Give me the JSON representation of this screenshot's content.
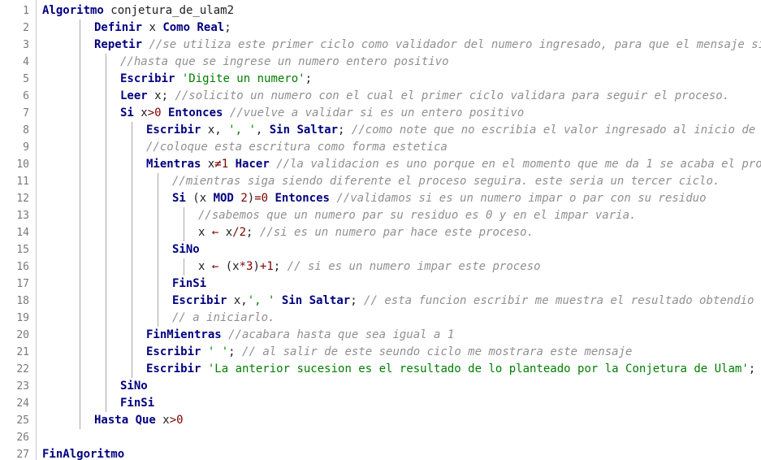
{
  "editor": {
    "lines": [
      {
        "n": "1",
        "indent": 0,
        "tokens": [
          [
            "kw",
            "Algoritmo"
          ],
          [
            "id",
            " conjetura_de_ulam2"
          ]
        ]
      },
      {
        "n": "2",
        "indent": 2,
        "tokens": [
          [
            "kw",
            "Definir"
          ],
          [
            "id",
            " x "
          ],
          [
            "kw",
            "Como"
          ],
          [
            "id",
            " "
          ],
          [
            "kw",
            "Real"
          ],
          [
            "id",
            ";"
          ]
        ]
      },
      {
        "n": "3",
        "indent": 2,
        "tokens": [
          [
            "kw",
            "Repetir"
          ],
          [
            "id",
            " "
          ],
          [
            "cm",
            "//se utiliza este primer ciclo como validador del numero ingresado, para que el mensaje siga m"
          ]
        ]
      },
      {
        "n": "4",
        "indent": 3,
        "tokens": [
          [
            "cm",
            "//hasta que se ingrese un numero entero positivo"
          ]
        ]
      },
      {
        "n": "5",
        "indent": 3,
        "tokens": [
          [
            "kw",
            "Escribir"
          ],
          [
            "id",
            " "
          ],
          [
            "st",
            "'Digite un numero'"
          ],
          [
            "id",
            ";"
          ]
        ]
      },
      {
        "n": "6",
        "indent": 3,
        "tokens": [
          [
            "kw",
            "Leer"
          ],
          [
            "id",
            " x; "
          ],
          [
            "cm",
            "//solicito un numero con el cual el primer ciclo validara para seguir el proceso."
          ]
        ]
      },
      {
        "n": "7",
        "indent": 3,
        "tokens": [
          [
            "kw",
            "Si"
          ],
          [
            "id",
            " x"
          ],
          [
            "op",
            ">"
          ],
          [
            "nm",
            "0"
          ],
          [
            "id",
            " "
          ],
          [
            "kw",
            "Entonces"
          ],
          [
            "id",
            " "
          ],
          [
            "cm",
            "//vuelve a validar si es un entero positivo"
          ]
        ]
      },
      {
        "n": "8",
        "indent": 4,
        "tokens": [
          [
            "kw",
            "Escribir"
          ],
          [
            "id",
            " x, "
          ],
          [
            "st",
            "', '"
          ],
          [
            "id",
            ", "
          ],
          [
            "kw",
            "Sin Saltar"
          ],
          [
            "id",
            "; "
          ],
          [
            "cm",
            "//como note que no escribia el valor ingresado al inicio de la"
          ]
        ]
      },
      {
        "n": "9",
        "indent": 4,
        "tokens": [
          [
            "cm",
            "//coloque esta escritura como forma estetica"
          ]
        ]
      },
      {
        "n": "10",
        "indent": 4,
        "tokens": [
          [
            "kw",
            "Mientras"
          ],
          [
            "id",
            " x"
          ],
          [
            "op",
            "≠"
          ],
          [
            "nm",
            "1"
          ],
          [
            "id",
            " "
          ],
          [
            "kw",
            "Hacer"
          ],
          [
            "id",
            " "
          ],
          [
            "cm",
            "//la validacion es uno porque en el momento que me da 1 se acaba el proble"
          ]
        ]
      },
      {
        "n": "11",
        "indent": 5,
        "tokens": [
          [
            "cm",
            "//mientras siga siendo diferente el proceso seguira. este seria un tercer ciclo."
          ]
        ]
      },
      {
        "n": "12",
        "indent": 5,
        "tokens": [
          [
            "kw",
            "Si"
          ],
          [
            "id",
            " (x "
          ],
          [
            "kw",
            "MOD"
          ],
          [
            "id",
            " "
          ],
          [
            "nm",
            "2"
          ],
          [
            "id",
            ")"
          ],
          [
            "op",
            "="
          ],
          [
            "nm",
            "0"
          ],
          [
            "id",
            " "
          ],
          [
            "kw",
            "Entonces"
          ],
          [
            "id",
            " "
          ],
          [
            "cm",
            "//validamos si es un numero impar o par con su residuo"
          ]
        ]
      },
      {
        "n": "13",
        "indent": 6,
        "tokens": [
          [
            "cm",
            "//sabemos que un numero par su residuo es 0 y en el impar varia."
          ]
        ]
      },
      {
        "n": "14",
        "indent": 6,
        "tokens": [
          [
            "id",
            "x "
          ],
          [
            "op",
            "←"
          ],
          [
            "id",
            " x"
          ],
          [
            "op",
            "/"
          ],
          [
            "nm",
            "2"
          ],
          [
            "id",
            "; "
          ],
          [
            "cm",
            "//si es un numero par hace este proceso."
          ]
        ]
      },
      {
        "n": "15",
        "indent": 5,
        "tokens": [
          [
            "kw",
            "SiNo"
          ]
        ]
      },
      {
        "n": "16",
        "indent": 6,
        "tokens": [
          [
            "id",
            "x "
          ],
          [
            "op",
            "←"
          ],
          [
            "id",
            " (x"
          ],
          [
            "op",
            "*"
          ],
          [
            "nm",
            "3"
          ],
          [
            "id",
            ")"
          ],
          [
            "op",
            "+"
          ],
          [
            "nm",
            "1"
          ],
          [
            "id",
            "; "
          ],
          [
            "cm",
            "// si es un numero impar este proceso"
          ]
        ]
      },
      {
        "n": "17",
        "indent": 5,
        "tokens": [
          [
            "kw",
            "FinSi"
          ]
        ]
      },
      {
        "n": "18",
        "indent": 5,
        "tokens": [
          [
            "kw",
            "Escribir"
          ],
          [
            "id",
            " x,"
          ],
          [
            "st",
            "', '"
          ],
          [
            "id",
            " "
          ],
          [
            "kw",
            "Sin Saltar"
          ],
          [
            "id",
            "; "
          ],
          [
            "cm",
            "// esta funcion escribir me muestra el resultado obtendio an"
          ]
        ]
      },
      {
        "n": "19",
        "indent": 5,
        "tokens": [
          [
            "cm",
            "// a iniciarlo."
          ]
        ]
      },
      {
        "n": "20",
        "indent": 4,
        "tokens": [
          [
            "kw",
            "FinMientras"
          ],
          [
            "id",
            " "
          ],
          [
            "cm",
            "//acabara hasta que sea igual a 1"
          ]
        ]
      },
      {
        "n": "21",
        "indent": 4,
        "tokens": [
          [
            "kw",
            "Escribir"
          ],
          [
            "id",
            " "
          ],
          [
            "st",
            "' '"
          ],
          [
            "id",
            "; "
          ],
          [
            "cm",
            "// al salir de este seundo ciclo me mostrara este mensaje"
          ]
        ]
      },
      {
        "n": "22",
        "indent": 4,
        "tokens": [
          [
            "kw",
            "Escribir"
          ],
          [
            "id",
            " "
          ],
          [
            "st",
            "'La anterior sucesion es el resultado de lo planteado por la Conjetura de Ulam'"
          ],
          [
            "id",
            ";"
          ]
        ]
      },
      {
        "n": "23",
        "indent": 3,
        "tokens": [
          [
            "kw",
            "SiNo"
          ]
        ]
      },
      {
        "n": "24",
        "indent": 3,
        "tokens": [
          [
            "kw",
            "FinSi"
          ]
        ]
      },
      {
        "n": "25",
        "indent": 2,
        "tokens": [
          [
            "kw",
            "Hasta Que"
          ],
          [
            "id",
            " x"
          ],
          [
            "op",
            ">"
          ],
          [
            "nm",
            "0"
          ]
        ]
      },
      {
        "n": "26",
        "indent": 0,
        "tokens": []
      },
      {
        "n": "27",
        "indent": 0,
        "tokens": [
          [
            "kw",
            "FinAlgoritmo"
          ]
        ]
      }
    ],
    "guides": [
      {
        "level": 2,
        "from": "2",
        "to": "25"
      },
      {
        "level": 3,
        "from": "4",
        "to": "24"
      },
      {
        "level": 4,
        "from": "8",
        "to": "22"
      },
      {
        "level": 5,
        "from": "11",
        "to": "19"
      },
      {
        "level": 6,
        "from": "13",
        "to": "14"
      },
      {
        "level": 6,
        "from": "16",
        "to": "16"
      }
    ]
  }
}
